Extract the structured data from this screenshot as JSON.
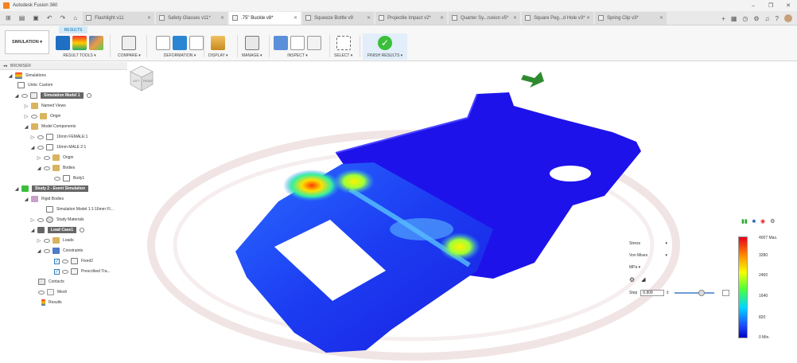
{
  "app": {
    "title": "Autodesk Fusion 360"
  },
  "window_controls": [
    "–",
    "❐",
    "✕"
  ],
  "tabs": [
    {
      "label": "Flashlight v11",
      "active": false
    },
    {
      "label": "Safety Glasses v11*",
      "active": false
    },
    {
      "label": ".75\" Buckle v8*",
      "active": true
    },
    {
      "label": "Squeeze Bottle v9",
      "active": false
    },
    {
      "label": "Projectile Impact v2*",
      "active": false
    },
    {
      "label": "Quarter Sy...ruxion v5*",
      "active": false
    },
    {
      "label": "Square Peg...d Hole v3*",
      "active": false
    },
    {
      "label": "Spring Clip v3*",
      "active": false
    }
  ],
  "ribbon": {
    "workspace": "SIMULATION ▾",
    "active_tab": "RESULTS",
    "groups": {
      "result_tools": "RESULT TOOLS ▾",
      "compare": "COMPARE ▾",
      "deformation": "DEFORMATION ▾",
      "display": "DISPLAY ▾",
      "manage": "MANAGE ▾",
      "inspect": "INSPECT ▾",
      "select": "SELECT ▾",
      "finish": "FINISH RESULTS ▾"
    }
  },
  "browser": {
    "title": "BROWSER",
    "nodes": [
      {
        "label": "Simulations"
      },
      {
        "label": "Units: Custom"
      },
      {
        "label": "Simulation Model 1"
      },
      {
        "label": "Named Views"
      },
      {
        "label": "Origin"
      },
      {
        "label": "Model Components"
      },
      {
        "label": "16mm FEMALE:1"
      },
      {
        "label": "16mm MALE 2:1"
      },
      {
        "label": "Origin"
      },
      {
        "label": "Bodies"
      },
      {
        "label": "Body1"
      },
      {
        "label": "Study 2 - Event Simulation"
      },
      {
        "label": "Rigid Bodies"
      },
      {
        "label": "Simulation Model 1:1:16mm FI..."
      },
      {
        "label": "Study Materials"
      },
      {
        "label": "Load Case1"
      },
      {
        "label": "Loads"
      },
      {
        "label": "Constraints"
      },
      {
        "label": "Fixed2"
      },
      {
        "label": "Prescribed Tra..."
      },
      {
        "label": "Contacts"
      },
      {
        "label": "Mesh"
      },
      {
        "label": "Results"
      }
    ]
  },
  "results_panel": {
    "result_type": "Stress",
    "component": "Von Mises",
    "unit": "MPa ▾",
    "step_label": "Step",
    "step_value": "8.808",
    "playback": [
      "▮▮",
      "■",
      "◉",
      "⚙"
    ]
  },
  "legend": {
    "ticks": [
      "4007 Max.",
      "3280",
      "2460",
      "1640",
      "820",
      "0 Min."
    ]
  },
  "viewcube": {
    "face_label": "LEFT",
    "face_label2": "FRONT"
  },
  "colors": {
    "accent": "#0a6bb0",
    "finish_green": "#3bbf3b",
    "model_blue": "#1f12e6"
  }
}
